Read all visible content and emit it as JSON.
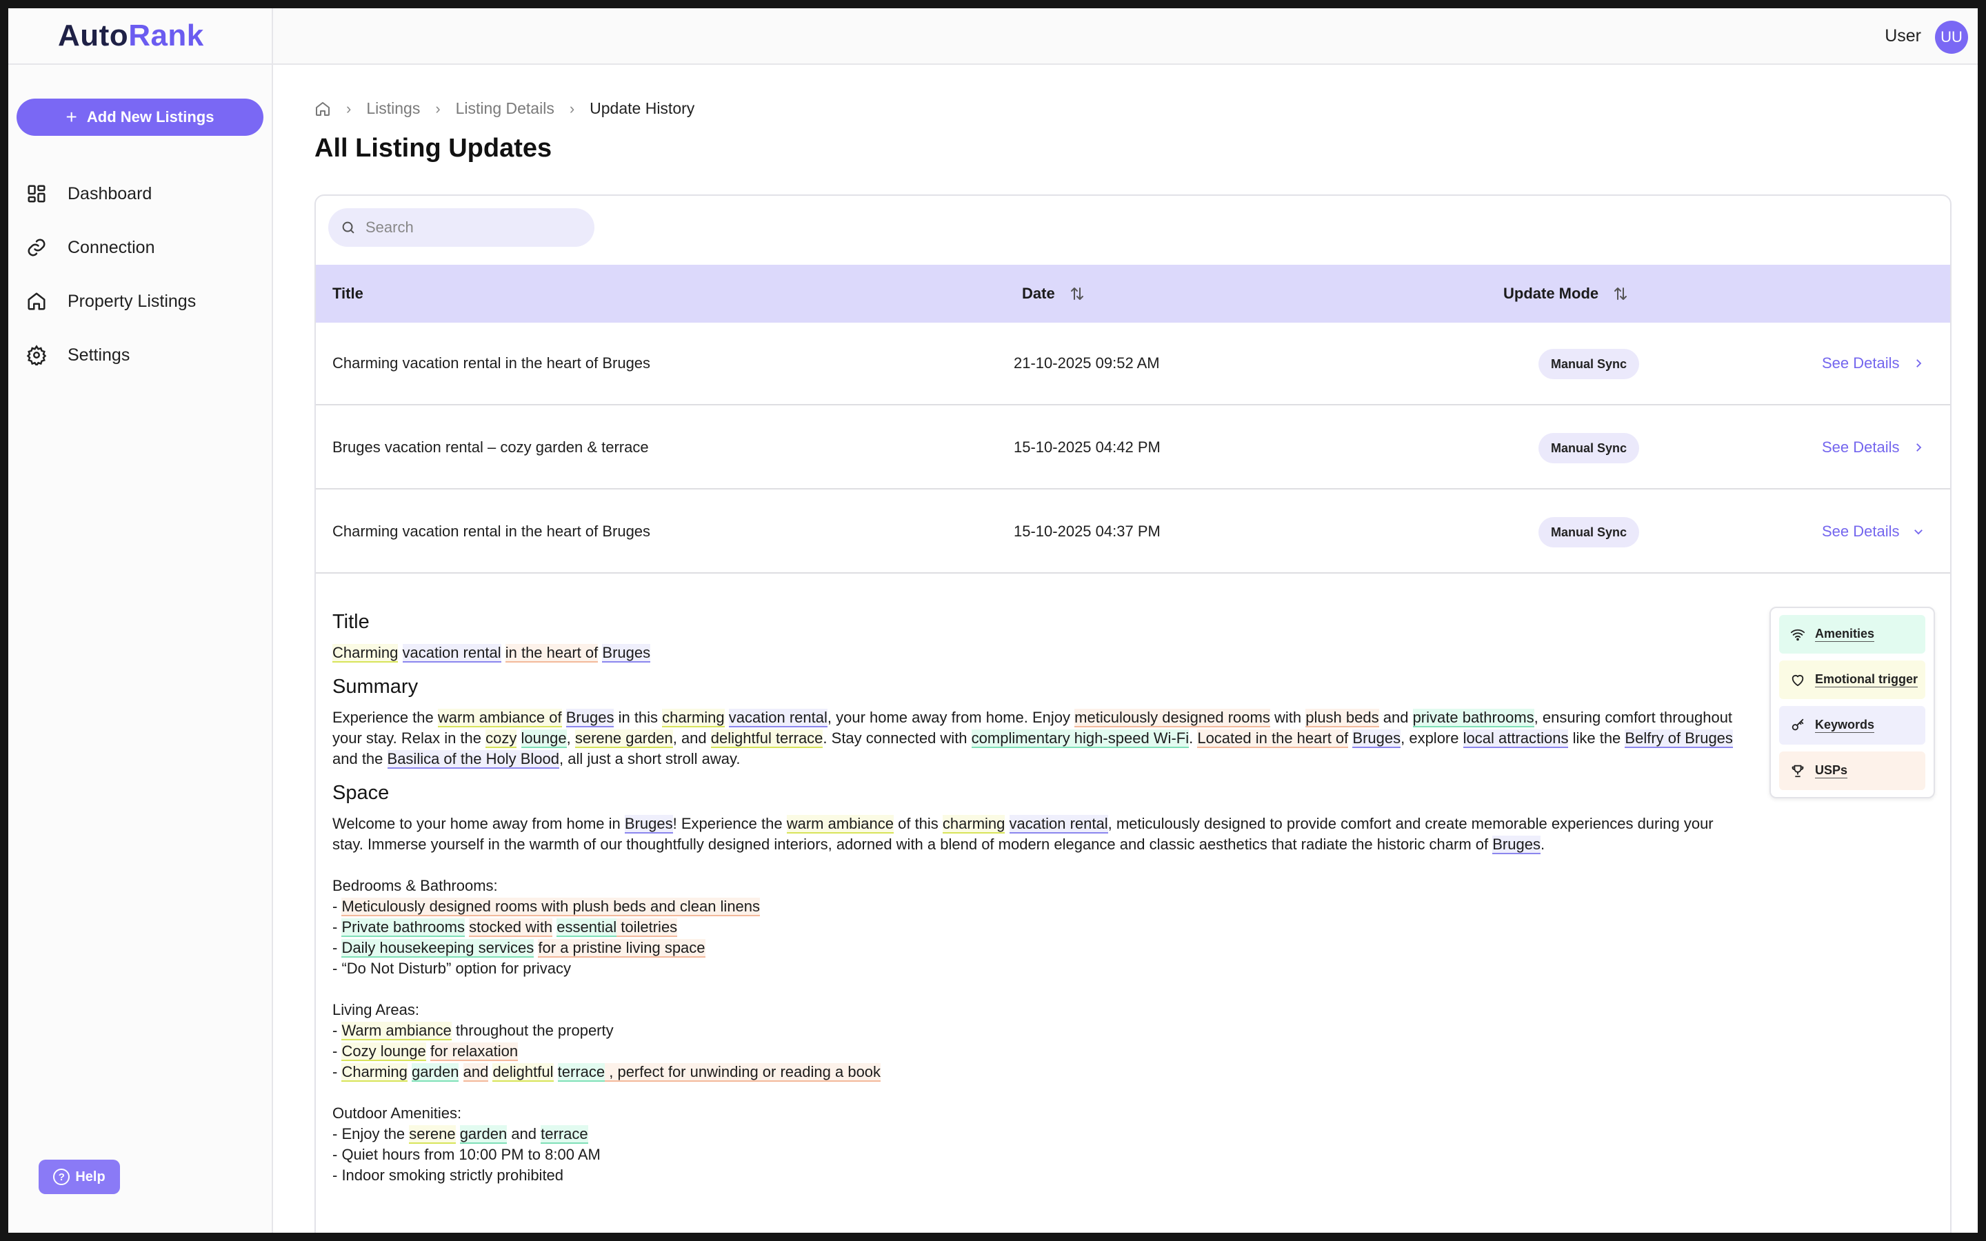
{
  "app": {
    "logo_text_a": "Auto",
    "logo_text_b": "Rank",
    "brand_color": "#7a68f4"
  },
  "sidebar": {
    "add_button_label": "Add New Listings",
    "items": [
      {
        "label": "Dashboard",
        "icon": "dashboard-icon"
      },
      {
        "label": "Connection",
        "icon": "link-icon"
      },
      {
        "label": "Property Listings",
        "icon": "home-icon"
      },
      {
        "label": "Settings",
        "icon": "gear-icon"
      }
    ],
    "help_label": "Help"
  },
  "topbar": {
    "user_name": "User",
    "avatar_initials": "UU"
  },
  "breadcrumb": {
    "items": [
      "Listings",
      "Listing Details"
    ],
    "current": "Update History"
  },
  "page": {
    "title": "All Listing Updates"
  },
  "search": {
    "placeholder": "Search"
  },
  "table": {
    "columns": {
      "title": "Title",
      "date": "Date",
      "mode": "Update Mode"
    },
    "rows": [
      {
        "title": "Charming vacation rental in the heart of Bruges",
        "date": "21-10-2025 09:52 AM",
        "mode": "Manual Sync",
        "action": "See Details"
      },
      {
        "title": "Bruges vacation rental – cozy garden & terrace",
        "date": "15-10-2025 04:42 PM",
        "mode": "Manual Sync",
        "action": "See Details"
      },
      {
        "title": "Charming vacation rental in the heart of Bruges",
        "date": "15-10-2025 04:37 PM",
        "mode": "Manual Sync",
        "action": "See Details"
      }
    ]
  },
  "detail": {
    "title_heading": "Title",
    "summary_heading": "Summary",
    "space_heading": "Space",
    "bedrooms_heading": "Bedrooms & Bathrooms:",
    "living_heading": "Living Areas:",
    "outdoor_heading": "Outdoor Amenities:",
    "bed_item4": "- “Do Not Disturb” option for privacy",
    "out_item2": "- Quiet hours from 10:00 PM to 8:00 AM",
    "out_item3": "- Indoor smoking strictly prohibited"
  },
  "legend": {
    "items": [
      {
        "label": "Amenities",
        "color": "#e2fbf0",
        "icon": "wifi-icon"
      },
      {
        "label": "Emotional trigger",
        "color": "#fbfbe4",
        "icon": "heart-icon"
      },
      {
        "label": "Keywords",
        "color": "#efeffc",
        "icon": "key-icon"
      },
      {
        "label": "USPs",
        "color": "#fdf2ea",
        "icon": "trophy-icon"
      }
    ]
  }
}
